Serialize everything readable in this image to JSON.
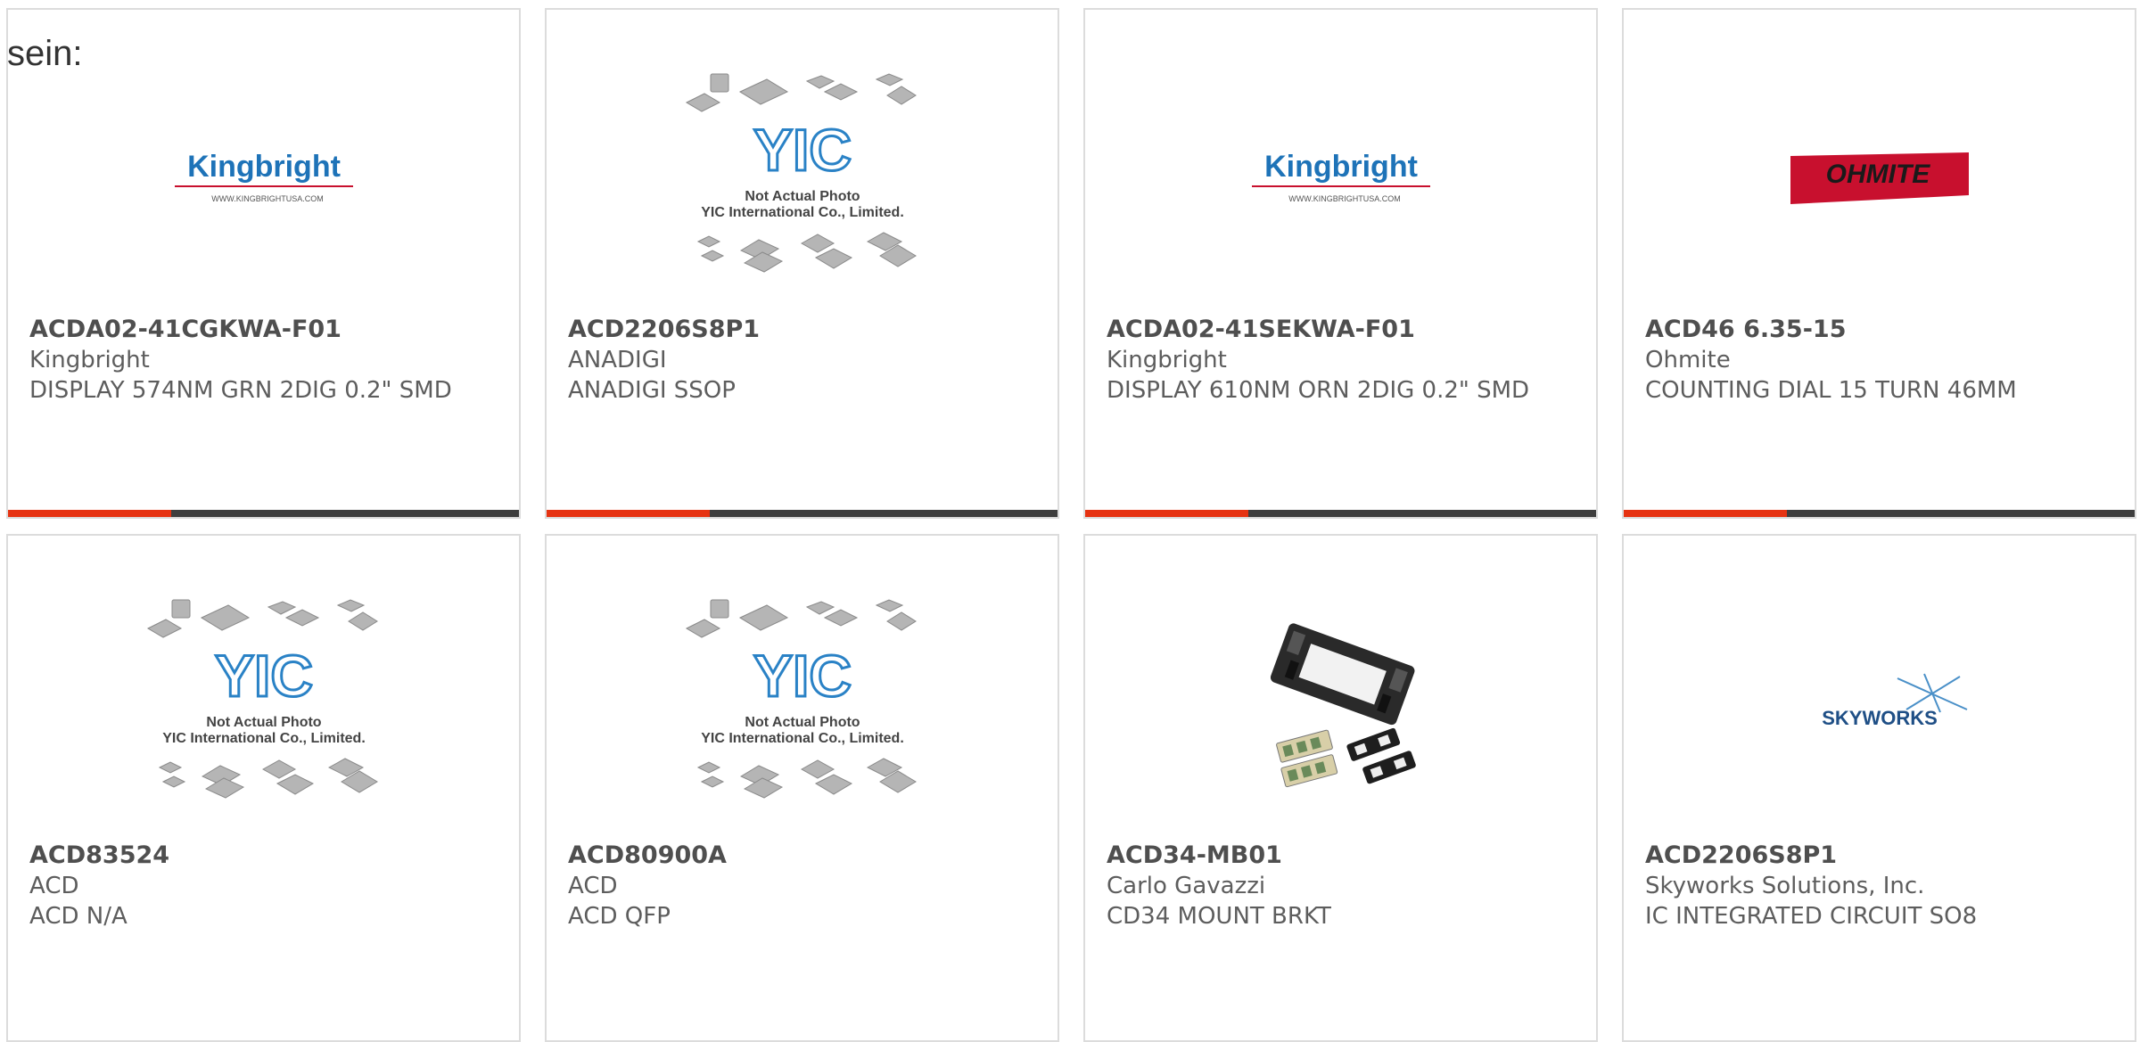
{
  "intro_text": "sein:",
  "colors": {
    "accent_bar": "#e63312",
    "dark_bar": "#3e3e3e",
    "card_border": "#dcdcdc"
  },
  "image_texts": {
    "kingbright_logo": "Kingbright",
    "kingbright_url": "WWW.KINGBRIGHTUSA.COM",
    "yic_logo": "YIC",
    "yic_caption_line1": "Not Actual Photo",
    "yic_caption_line2": "YIC International Co., Limited.",
    "ohmite_logo": "OHMITE",
    "skyworks_logo": "SKYWORKS"
  },
  "products": [
    {
      "part_number": "ACDA02-41CGKWA-F01",
      "manufacturer": "Kingbright",
      "description": "DISPLAY 574NM GRN 2DIG 0.2\" SMD",
      "image": "kingbright-logo"
    },
    {
      "part_number": "ACD2206S8P1",
      "manufacturer": "ANADIGI",
      "description": "ANADIGI SSOP",
      "image": "yic-placeholder"
    },
    {
      "part_number": "ACDA02-41SEKWA-F01",
      "manufacturer": "Kingbright",
      "description": "DISPLAY 610NM ORN 2DIG 0.2\" SMD",
      "image": "kingbright-logo"
    },
    {
      "part_number": "ACD46 6.35-15",
      "manufacturer": "Ohmite",
      "description": "COUNTING DIAL 15 TURN 46MM",
      "image": "ohmite-logo"
    },
    {
      "part_number": "ACD83524",
      "manufacturer": "ACD",
      "description": "ACD N/A",
      "image": "yic-placeholder"
    },
    {
      "part_number": "ACD80900A",
      "manufacturer": "ACD",
      "description": "ACD QFP",
      "image": "yic-placeholder"
    },
    {
      "part_number": "ACD34-MB01",
      "manufacturer": "Carlo Gavazzi",
      "description": "CD34 MOUNT BRKT",
      "image": "mounting-bracket-photo"
    },
    {
      "part_number": "ACD2206S8P1",
      "manufacturer": "Skyworks Solutions, Inc.",
      "description": "IC INTEGRATED CIRCUIT SO8",
      "image": "skyworks-logo"
    }
  ]
}
